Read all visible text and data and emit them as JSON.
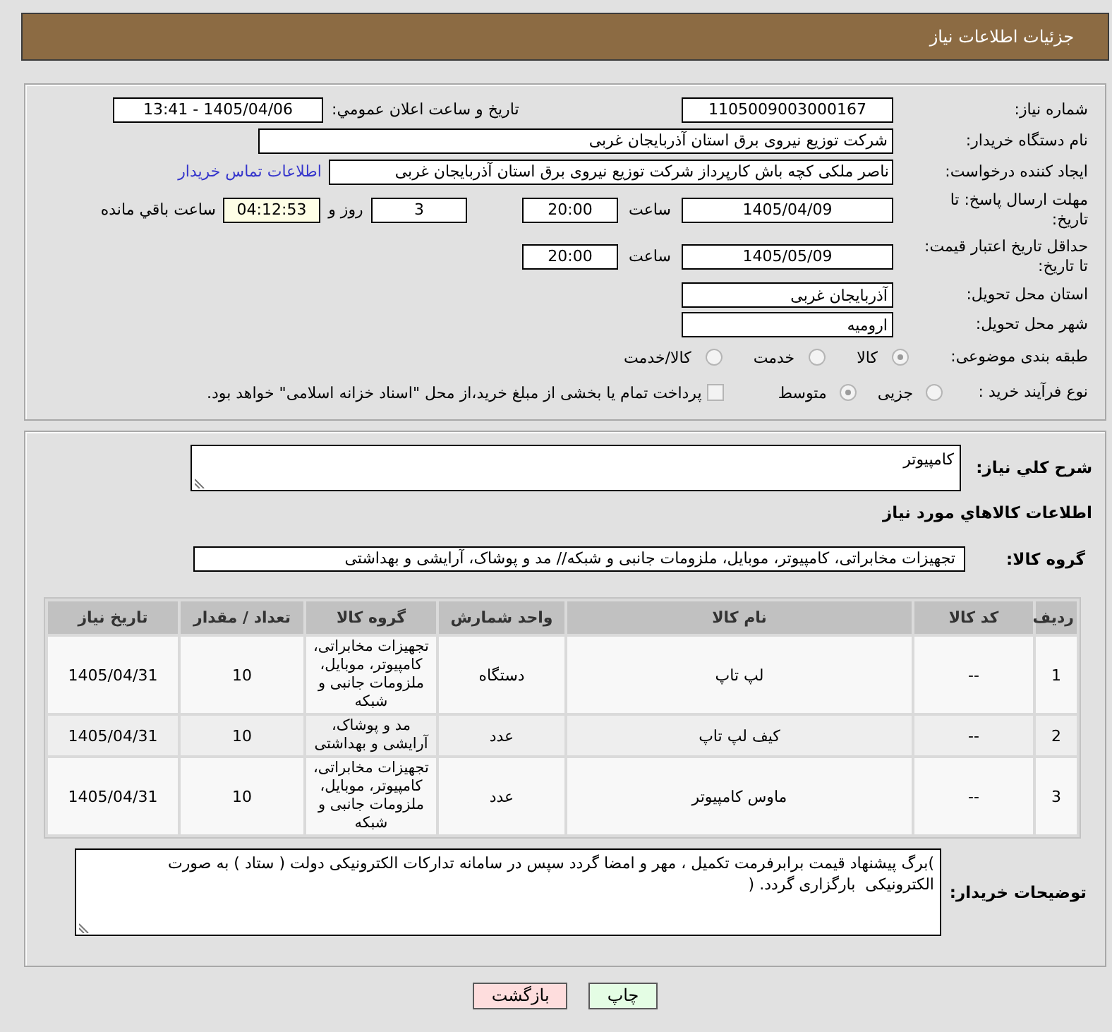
{
  "header": {
    "title": "جزئیات اطلاعات نیاز"
  },
  "details": {
    "need_number": {
      "label": "شماره نیاز:",
      "value": "1105009003000167"
    },
    "announcement": {
      "label": "تاریخ و ساعت اعلان عمومي:",
      "value": "1405/04/06 - 13:41"
    },
    "buyer": {
      "label": "نام دستگاه خریدار:",
      "value": "شرکت توزیع نیروی برق استان آذربایجان غربی"
    },
    "requester": {
      "label": "ایجاد کننده درخواست:",
      "value": "ناصر ملکی کچه باش کارپرداز شرکت توزیع نیروی برق استان آذربایجان غربی",
      "contact_link": "اطلاعات تماس خریدار"
    },
    "response_deadline": {
      "label": "مهلت ارسال پاسخ: تا تاریخ:",
      "date": "1405/04/09",
      "time_label": "ساعت",
      "time": "20:00",
      "days": "3",
      "days_label": "روز و",
      "remaining": "04:12:53",
      "remaining_label": "ساعت باقي مانده"
    },
    "price_validity": {
      "label": "حداقل تاریخ اعتبار قیمت: تا تاریخ:",
      "date": "1405/05/09",
      "time_label": "ساعت",
      "time": "20:00"
    },
    "delivery_province": {
      "label": "استان محل تحویل:",
      "value": "آذربایجان غربی"
    },
    "delivery_city": {
      "label": "شهر محل تحویل:",
      "value": "ارومیه"
    },
    "subject_category": {
      "label": "طبقه بندی موضوعی:",
      "options": [
        {
          "label": "کالا",
          "selected": true
        },
        {
          "label": "خدمت",
          "selected": false
        },
        {
          "label": "کالا/خدمت",
          "selected": false
        }
      ]
    },
    "purchase_process": {
      "label": "نوع فرآیند خرید :",
      "options": [
        {
          "label": "جزیی",
          "selected": false
        },
        {
          "label": "متوسط",
          "selected": true
        }
      ],
      "treasury_payment": {
        "label": "پرداخت تمام یا بخشی از مبلغ خرید،از محل \"اسناد خزانه اسلامی\" خواهد بود.",
        "checked": false
      }
    }
  },
  "goods": {
    "summary": {
      "label": "شرح کلي نیاز:",
      "value": "کامپیوتر"
    },
    "section_title": "اطلاعات کالاهاي مورد نياز",
    "group": {
      "label": "گروه کالا:",
      "value": "تجهیزات مخابراتی، کامپیوتر، موبایل، ملزومات جانبی و شبکه// مد و پوشاک، آرایشی و بهداشتی"
    },
    "table": {
      "columns": [
        "ردیف",
        "کد کالا",
        "نام کالا",
        "واحد شمارش",
        "گروه کالا",
        "تعداد / مقدار",
        "تاریخ نیاز"
      ],
      "rows": [
        [
          "1",
          "--",
          "لپ تاپ",
          "دستگاه",
          "تجهیزات مخابراتی، کامپیوتر، موبایل، ملزومات جانبی و شبکه",
          "10",
          "1405/04/31"
        ],
        [
          "2",
          "--",
          "کیف لپ تاپ",
          "عدد",
          "مد و پوشاک، آرایشی و بهداشتی",
          "10",
          "1405/04/31"
        ],
        [
          "3",
          "--",
          "ماوس کامپیوتر",
          "عدد",
          "تجهیزات مخابراتی، کامپیوتر، موبایل، ملزومات جانبی و شبکه",
          "10",
          "1405/04/31"
        ]
      ]
    },
    "buyer_notes": {
      "label": "توضیحات خریدار:",
      "value": ")برگ پیشنهاد قیمت برابرفرمت تکمیل ، مهر و امضا گردد سپس در سامانه تدارکات الکترونیکی دولت ( ستاد ) به صورت الکترونیکی  بارگزاری گردد. ("
    }
  },
  "buttons": [
    {
      "kind": "print",
      "label": "چاپ"
    },
    {
      "kind": "back",
      "label": "بازگشت"
    }
  ]
}
